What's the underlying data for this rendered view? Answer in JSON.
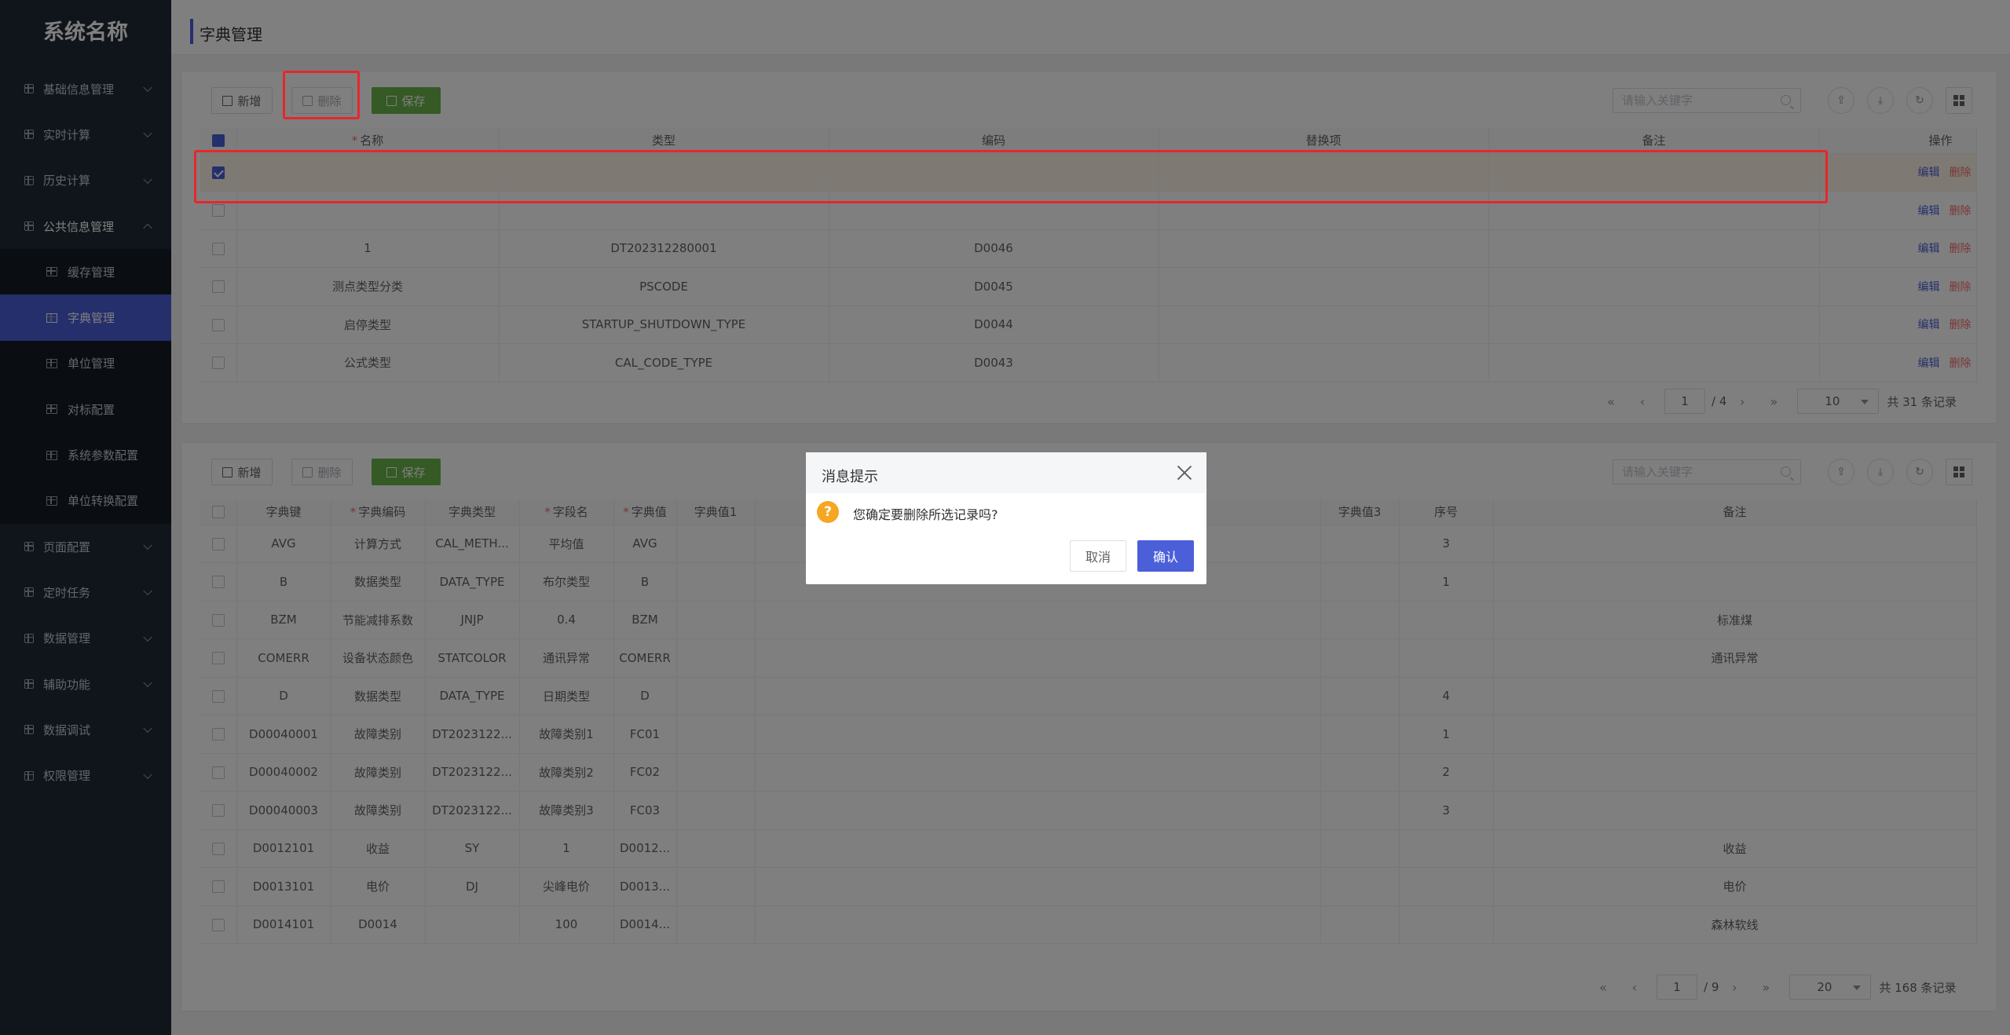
{
  "sidebar": {
    "title": "系统名称",
    "items": [
      {
        "label": "基础信息管理"
      },
      {
        "label": "实时计算"
      },
      {
        "label": "历史计算"
      },
      {
        "label": "公共信息管理"
      },
      {
        "label": "页面配置"
      },
      {
        "label": "定时任务"
      },
      {
        "label": "数据管理"
      },
      {
        "label": "辅助功能"
      },
      {
        "label": "数据调试"
      },
      {
        "label": "权限管理"
      }
    ],
    "sub_items": [
      {
        "label": "缓存管理"
      },
      {
        "label": "字典管理"
      },
      {
        "label": "单位管理"
      },
      {
        "label": "对标配置"
      },
      {
        "label": "系统参数配置"
      },
      {
        "label": "单位转换配置"
      }
    ]
  },
  "header": {
    "title": "字典管理"
  },
  "toolbar": {
    "add": "新增",
    "delete": "删除",
    "save": "保存",
    "search_placeholder": "请输入关键字"
  },
  "top_table": {
    "headers": {
      "name": "名称",
      "type": "类型",
      "code": "编码",
      "replace": "替换项",
      "remark": "备注",
      "ops": "操作"
    },
    "rows": [
      {
        "name": "",
        "type": "",
        "code": "",
        "replace": "",
        "remark": ""
      },
      {
        "name": "",
        "type": "",
        "code": "",
        "replace": "",
        "remark": ""
      },
      {
        "name": "1",
        "type": "DT202312280001",
        "code": "D0046",
        "replace": "",
        "remark": ""
      },
      {
        "name": "测点类型分类",
        "type": "PSCODE",
        "code": "D0045",
        "replace": "",
        "remark": ""
      },
      {
        "name": "启停类型",
        "type": "STARTUP_SHUTDOWN_TYPE",
        "code": "D0044",
        "replace": "",
        "remark": ""
      },
      {
        "name": "公式类型",
        "type": "CAL_CODE_TYPE",
        "code": "D0043",
        "replace": "",
        "remark": ""
      }
    ],
    "edit": "编辑",
    "del": "删除",
    "pager": {
      "page": "1",
      "total_pages": "/ 4",
      "page_size": "10",
      "total": "共 31 条记录"
    }
  },
  "bottom_table": {
    "headers": {
      "key": "字典键",
      "dcode": "字典编码",
      "dtype": "字典类型",
      "field": "字段名",
      "value": "字典值",
      "value1": "字典值1",
      "value3": "字典值3",
      "seq": "序号",
      "remark": "备注"
    },
    "rows": [
      {
        "key": "AVG",
        "dcode": "计算方式",
        "dtype": "CAL_METH...",
        "field": "平均值",
        "value": "AVG",
        "seq": "3",
        "remark": ""
      },
      {
        "key": "B",
        "dcode": "数据类型",
        "dtype": "DATA_TYPE",
        "field": "布尔类型",
        "value": "B",
        "seq": "1",
        "remark": ""
      },
      {
        "key": "BZM",
        "dcode": "节能减排系数",
        "dtype": "JNJP",
        "field": "0.4",
        "value": "BZM",
        "seq": "",
        "remark": "标准煤"
      },
      {
        "key": "COMERR",
        "dcode": "设备状态颜色",
        "dtype": "STATCOLOR",
        "field": "通讯异常",
        "value": "COMERR",
        "seq": "",
        "remark": "通讯异常"
      },
      {
        "key": "D",
        "dcode": "数据类型",
        "dtype": "DATA_TYPE",
        "field": "日期类型",
        "value": "D",
        "seq": "4",
        "remark": ""
      },
      {
        "key": "D00040001",
        "dcode": "故障类别",
        "dtype": "DT2023122...",
        "field": "故障类别1",
        "value": "FC01",
        "seq": "1",
        "remark": ""
      },
      {
        "key": "D00040002",
        "dcode": "故障类别",
        "dtype": "DT2023122...",
        "field": "故障类别2",
        "value": "FC02",
        "seq": "2",
        "remark": ""
      },
      {
        "key": "D00040003",
        "dcode": "故障类别",
        "dtype": "DT2023122...",
        "field": "故障类别3",
        "value": "FC03",
        "seq": "3",
        "remark": ""
      },
      {
        "key": "D0012101",
        "dcode": "收益",
        "dtype": "SY",
        "field": "1",
        "value": "D0012...",
        "seq": "",
        "remark": "收益"
      },
      {
        "key": "D0013101",
        "dcode": "电价",
        "dtype": "DJ",
        "field": "尖峰电价",
        "value": "D0013...",
        "seq": "",
        "remark": "电价"
      },
      {
        "key": "D0014101",
        "dcode": "D0014",
        "dtype": "",
        "field": "100",
        "value": "D0014...",
        "seq": "",
        "remark": "森林软线"
      }
    ],
    "pager": {
      "page": "1",
      "total_pages": "/ 9",
      "page_size": "20",
      "total": "共 168 条记录"
    }
  },
  "dialog": {
    "title": "消息提示",
    "message": "您确定要删除所选记录吗?",
    "cancel": "取消",
    "confirm": "确认"
  },
  "colors": {
    "accent": "#4b5fd9",
    "save": "#6bb54a",
    "danger": "#f56c6c",
    "highlight": "#e8262a"
  }
}
